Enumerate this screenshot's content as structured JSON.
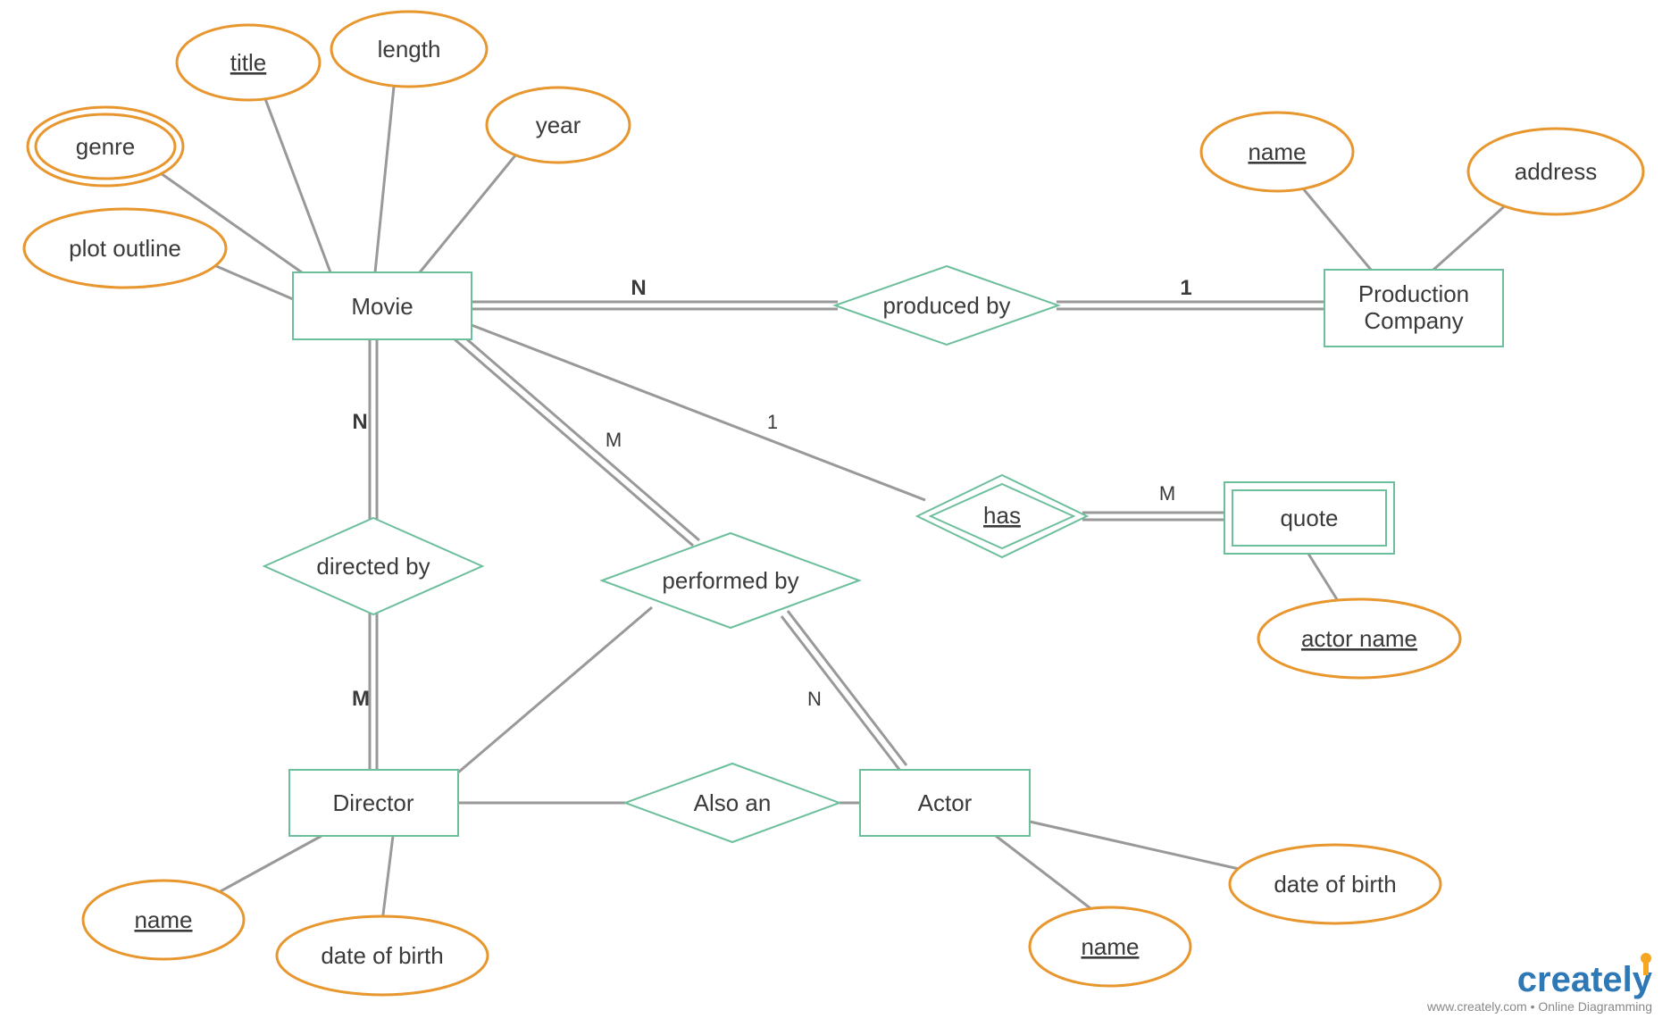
{
  "entities": {
    "movie": "Movie",
    "production_company_l1": "Production",
    "production_company_l2": "Company",
    "director": "Director",
    "actor": "Actor",
    "quote": "quote"
  },
  "relationships": {
    "produced_by": "produced by",
    "directed_by": "directed by",
    "performed_by": "performed by",
    "also_an": "Also an",
    "has": "has"
  },
  "attributes": {
    "genre": "genre",
    "title": "title",
    "length": "length",
    "year": "year",
    "plot_outline": "plot outline",
    "pc_name": "name",
    "pc_address": "address",
    "director_name": "name",
    "director_dob": "date of birth",
    "actor_name": "name",
    "actor_dob": "date of birth",
    "quote_actor_name": "actor name"
  },
  "cardinalities": {
    "movie_produced": "N",
    "pc_produced": "1",
    "movie_directed": "N",
    "director_directed": "M",
    "movie_performed": "M",
    "actor_performed": "N",
    "movie_has": "1",
    "quote_has": "M"
  },
  "branding": {
    "name": "creately",
    "tagline": "www.creately.com • Online Diagramming"
  },
  "colors": {
    "entity_stroke": "#6dbf9c",
    "attribute_stroke": "#e8962e",
    "line": "#999999",
    "brand_blue": "#2e78b5",
    "brand_orange": "#f5a623"
  }
}
